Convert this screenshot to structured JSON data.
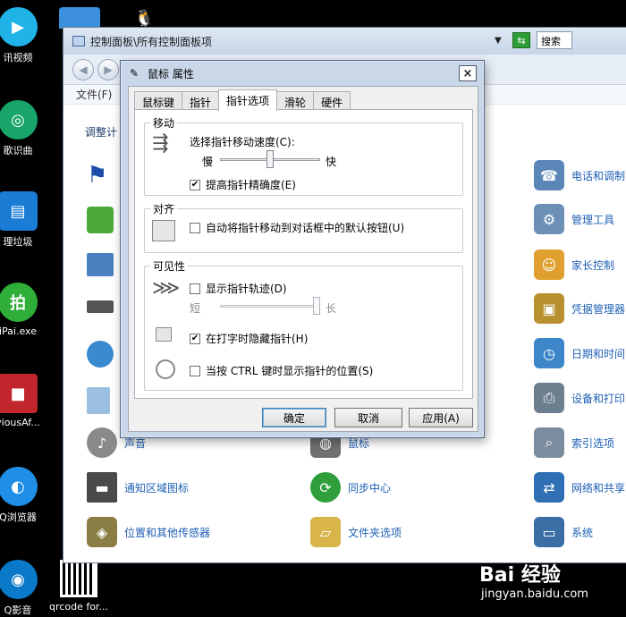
{
  "desktop": {
    "icons": [
      {
        "label": "讯视频",
        "color": "#1fb3e8",
        "glyph": "▶"
      },
      {
        "label": "歌识曲",
        "color": "#17a56a",
        "glyph": "◎"
      },
      {
        "label": "理垃圾",
        "color": "#1b7cd6",
        "glyph": "▤"
      },
      {
        "label": "iPai.exe",
        "color": "#2fae39",
        "glyph": "拍"
      },
      {
        "label": "viousAf...",
        "color": "#c0262b",
        "glyph": "■"
      },
      {
        "label": "Q浏览器",
        "color": "#1e8ee6",
        "glyph": "◐"
      },
      {
        "label": "Q影音",
        "color": "#0a79c9",
        "glyph": "◉"
      }
    ],
    "qrcode_label": "qrcode for..."
  },
  "cp_window": {
    "title": "控制面板\\所有控制面板项",
    "menu_file": "文件(F)",
    "search_placeholder": "搜索",
    "adjust_label": "调整计",
    "items": [
      {
        "label": "电话和调制",
        "color": "#5b87b8",
        "glyph": "☎"
      },
      {
        "label": "管理工具",
        "color": "#6c8fb7",
        "glyph": "⚙"
      },
      {
        "label": "家长控制",
        "color": "#e0a030",
        "glyph": "☺"
      },
      {
        "label": "凭据管理器",
        "color": "#b8912f",
        "glyph": "▣"
      },
      {
        "label": "日期和时间",
        "color": "#3d86c9",
        "glyph": "◷"
      },
      {
        "label": "设备和打印",
        "color": "#6d7e8f",
        "glyph": "⎙"
      },
      {
        "label": "索引选项",
        "color": "#7a8c9e",
        "glyph": "⌕"
      },
      {
        "label": "网络和共享",
        "color": "#2f6fb4",
        "glyph": "⇄"
      },
      {
        "label": "系统",
        "color": "#3a6ea5",
        "glyph": "▭"
      },
      {
        "label": "声音",
        "color": "#8a8a8a",
        "glyph": "♪"
      },
      {
        "label": "鼠标",
        "color": "#707070",
        "glyph": "◍"
      },
      {
        "label": "通知区域图标",
        "color": "#4a4a4a",
        "glyph": "▬"
      },
      {
        "label": "同步中心",
        "color": "#2f9e3b",
        "glyph": "⟳"
      },
      {
        "label": "位置和其他传感器",
        "color": "#8a7e44",
        "glyph": "◈"
      },
      {
        "label": "文件夹选项",
        "color": "#d8b44a",
        "glyph": "▱"
      }
    ]
  },
  "dialog": {
    "title": "鼠标 属性",
    "close": "×",
    "tabs": [
      "鼠标键",
      "指针",
      "指针选项",
      "滑轮",
      "硬件"
    ],
    "active_tab": "指针选项",
    "motion": {
      "title": "移动",
      "speed_label": "选择指针移动速度(C):",
      "slow": "慢",
      "fast": "快",
      "speed_value": 0.5,
      "enhance_label": "提高指针精确度(E)",
      "enhance_checked": true
    },
    "snap": {
      "title": "对齐",
      "label": "自动将指针移动到对话框中的默认按钮(U)",
      "checked": false
    },
    "visibility": {
      "title": "可见性",
      "trails_label": "显示指针轨迹(D)",
      "trails_checked": false,
      "short": "短",
      "long": "长",
      "trails_value": 1.0,
      "hide_label": "在打字时隐藏指针(H)",
      "hide_checked": true,
      "ctrl_label": "当按 CTRL 键时显示指针的位置(S)",
      "ctrl_checked": false
    },
    "buttons": {
      "ok": "确定",
      "cancel": "取消",
      "apply": "应用(A)"
    }
  },
  "watermark": {
    "logo": "Bai 经验",
    "url": "jingyan.baidu.com"
  }
}
